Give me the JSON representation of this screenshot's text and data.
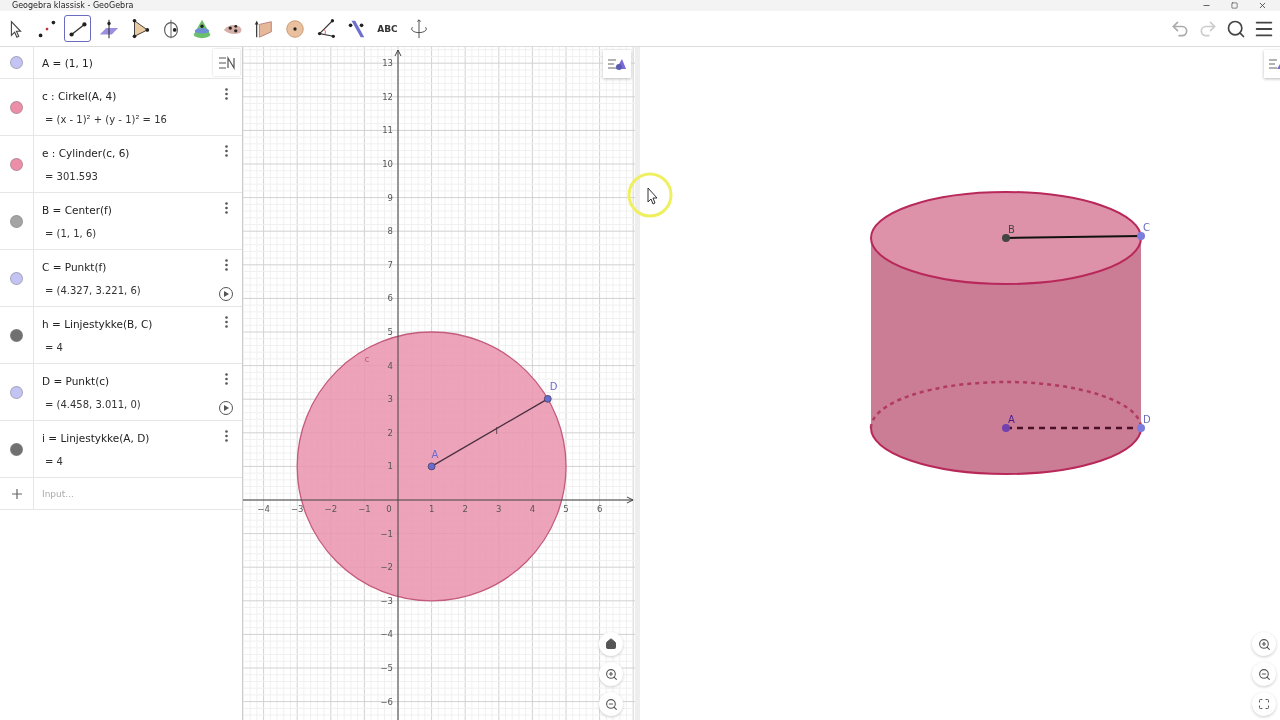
{
  "window": {
    "title": "Geogebra klassisk - GeoGebra"
  },
  "toolbar": {
    "tools": [
      {
        "kind": "move",
        "selected": false
      },
      {
        "kind": "point",
        "selected": false
      },
      {
        "kind": "segment",
        "selected": true
      },
      {
        "kind": "plane",
        "selected": false
      },
      {
        "kind": "pyramid",
        "selected": false
      },
      {
        "kind": "rotate",
        "selected": false
      },
      {
        "kind": "cone",
        "selected": false
      },
      {
        "kind": "blob",
        "selected": false
      },
      {
        "kind": "prism",
        "selected": false
      },
      {
        "kind": "sphere",
        "selected": false
      },
      {
        "kind": "angle",
        "selected": false
      },
      {
        "kind": "reflect",
        "selected": false
      },
      {
        "kind": "text",
        "label": "ABC",
        "selected": false
      },
      {
        "kind": "view",
        "selected": false
      }
    ]
  },
  "algebra": {
    "items": [
      {
        "color": "#c4c4f4",
        "definition": "A = (1, 1)"
      },
      {
        "color": "#ec8ea8",
        "definition": "c : Cirkel(A, 4)",
        "value": "= (x - 1)² + (y - 1)² = 16",
        "menu": true,
        "animate": false
      },
      {
        "color": "#ec8ea8",
        "definition": "e : Cylinder(c, 6)",
        "value": "= 301.593",
        "menu": true,
        "animate": false
      },
      {
        "color": "#a4a4a4",
        "definition": "B = Center(f)",
        "value": "= (1, 1, 6)",
        "menu": true,
        "animate": false
      },
      {
        "color": "#c4c4f4",
        "definition": "C = Punkt(f)",
        "value": "= (4.327, 3.221, 6)",
        "menu": true,
        "animate": true
      },
      {
        "color": "#707070",
        "definition": "h = Linjestykke(B, C)",
        "value": "= 4",
        "menu": true,
        "animate": false
      },
      {
        "color": "#c4c4f4",
        "definition": "D = Punkt(c)",
        "value": "= (4.458, 3.011, 0)",
        "menu": true,
        "animate": true
      },
      {
        "color": "#707070",
        "definition": "i = Linjestykke(A, D)",
        "value": "= 4",
        "menu": true,
        "animate": false
      }
    ],
    "input": {
      "placeholder": "Input..."
    }
  },
  "graphics": {
    "x_labels": [
      "−4",
      "−3",
      "−2",
      "−1",
      "0",
      "1",
      "2",
      "3",
      "4",
      "5",
      "6"
    ],
    "y_labels": [
      "13",
      "12",
      "11",
      "10",
      "9",
      "8",
      "7",
      "6",
      "5",
      "4",
      "3",
      "2",
      "1",
      "−1",
      "−2",
      "−3",
      "−4",
      "−5",
      "−6"
    ],
    "circle_label": "c",
    "segment_label": "i",
    "points": [
      {
        "label": "A"
      },
      {
        "label": "D"
      }
    ]
  },
  "graphics_3d": {
    "points": [
      {
        "label": "B"
      },
      {
        "label": "C"
      },
      {
        "label": "A"
      },
      {
        "label": "D"
      }
    ]
  }
}
